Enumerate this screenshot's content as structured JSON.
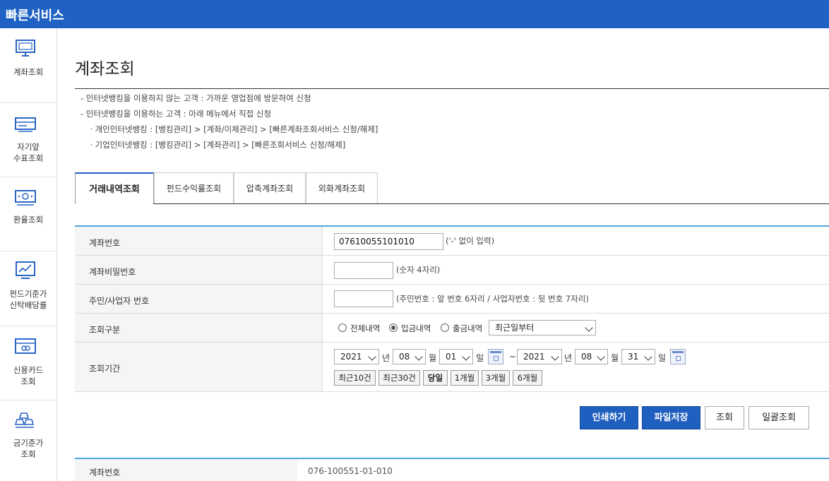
{
  "header": {
    "title": "빠른서비스"
  },
  "sidebar": {
    "items": [
      {
        "label": "계좌조회",
        "icon": "monitor-icon"
      },
      {
        "label": "자기앞\n수표조회",
        "icon": "check-icon"
      },
      {
        "label": "환율조회",
        "icon": "currency-icon"
      },
      {
        "label": "펀드기준가\n신탁배당률",
        "icon": "chart-icon"
      },
      {
        "label": "신용카드\n조회",
        "icon": "card-icon"
      },
      {
        "label": "금기준가\n조회",
        "icon": "gold-icon"
      }
    ]
  },
  "main": {
    "title": "계좌조회",
    "notes": [
      "- 인터넷뱅킹을 이용하지 않는 고객 : 가까운 영업점에 방문하여 신청",
      "- 인터넷뱅킹을 이용하는 고객 : 아래 메뉴에서 직접 신청",
      "ㆍ개인인터넷뱅킹 : [뱅킹관리] > [계좌/이체관리] > [빠른계좌조회서비스 신청/해제]",
      "ㆍ기업인터넷뱅킹 : [뱅킹관리] > [계좌관리] > [빠른조회서비스 신청/해제]"
    ],
    "tabs": [
      {
        "label": "거래내역조회"
      },
      {
        "label": "펀드수익률조회"
      },
      {
        "label": "압축계좌조회"
      },
      {
        "label": "외화계좌조회"
      }
    ]
  },
  "form": {
    "account_label": "계좌번호",
    "account_value": "07610055101010",
    "account_hint": "('-' 없이 입력)",
    "password_label": "계좌비밀번호",
    "password_hint": "(숫자 4자리)",
    "idnum_label": "주민/사업자 번호",
    "idnum_hint": "(주민번호 : 앞 번호 6자리 / 사업자번호 : 뒷 번호 7자리)",
    "type_label": "조회구분",
    "type_options": [
      "전체내역",
      "입금내역",
      "출금내역"
    ],
    "type_selected": "입금내역",
    "order_select": "최근일부터",
    "period_label": "조회기간",
    "start": {
      "year": "2021",
      "month": "08",
      "day": "01"
    },
    "end": {
      "year": "2021",
      "month": "08",
      "day": "31"
    },
    "unit_year": "년",
    "unit_month": "월",
    "unit_day": "일",
    "tilde": "~",
    "period_buttons": [
      "최근10건",
      "최근30건",
      "당일",
      "1개월",
      "3개월",
      "6개월"
    ]
  },
  "actions": {
    "print": "인쇄하기",
    "save_file": "파일저장",
    "search": "조회",
    "batch_search": "일괄조회"
  },
  "result": {
    "account_label": "계좌번호",
    "account_value": "076-100551-01-010"
  }
}
